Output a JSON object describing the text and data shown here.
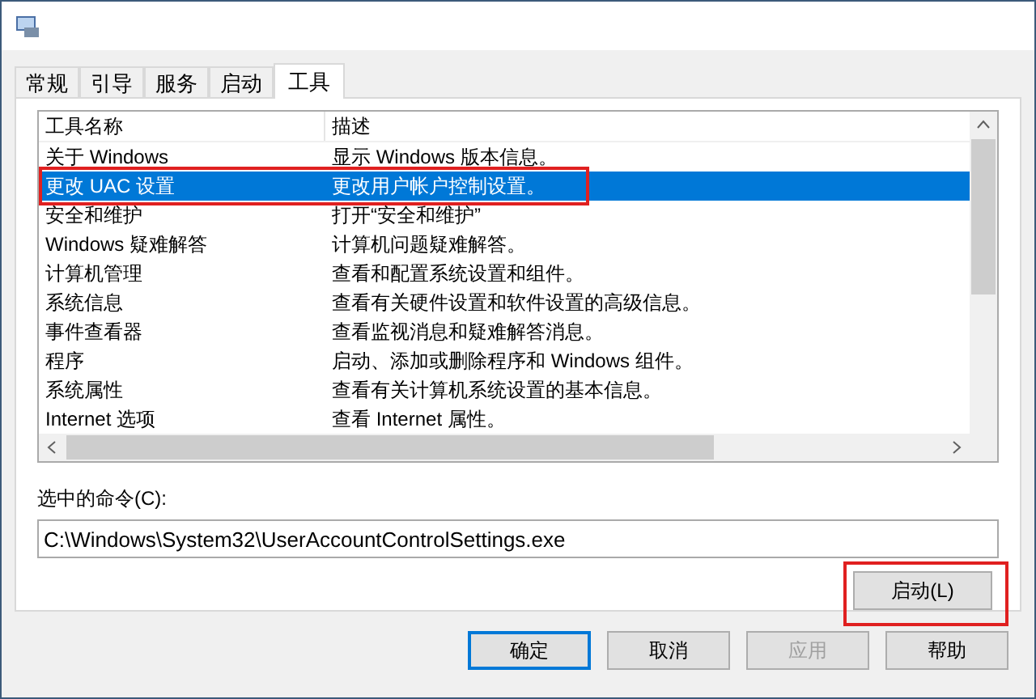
{
  "tabs": [
    {
      "label": "常规",
      "selected": false
    },
    {
      "label": "引导",
      "selected": false
    },
    {
      "label": "服务",
      "selected": false
    },
    {
      "label": "启动",
      "selected": false
    },
    {
      "label": "工具",
      "selected": true
    }
  ],
  "table": {
    "columns": [
      "工具名称",
      "描述"
    ],
    "rows": [
      {
        "name": "关于 Windows",
        "description": "显示 Windows 版本信息。",
        "selected": false,
        "highlighted": false
      },
      {
        "name": "更改 UAC 设置",
        "description": "更改用户帐户控制设置。",
        "selected": true,
        "highlighted": true
      },
      {
        "name": "安全和维护",
        "description": "打开“安全和维护”",
        "selected": false,
        "highlighted": false
      },
      {
        "name": "Windows 疑难解答",
        "description": "计算机问题疑难解答。",
        "selected": false,
        "highlighted": false
      },
      {
        "name": "计算机管理",
        "description": "查看和配置系统设置和组件。",
        "selected": false,
        "highlighted": false
      },
      {
        "name": "系统信息",
        "description": "查看有关硬件设置和软件设置的高级信息。",
        "selected": false,
        "highlighted": false
      },
      {
        "name": "事件查看器",
        "description": "查看监视消息和疑难解答消息。",
        "selected": false,
        "highlighted": false
      },
      {
        "name": "程序",
        "description": "启动、添加或删除程序和 Windows 组件。",
        "selected": false,
        "highlighted": false
      },
      {
        "name": "系统属性",
        "description": "查看有关计算机系统设置的基本信息。",
        "selected": false,
        "highlighted": false
      },
      {
        "name": "Internet 选项",
        "description": "查看 Internet 属性。",
        "selected": false,
        "highlighted": false
      }
    ]
  },
  "command": {
    "label": "选中的命令(C):",
    "value": "C:\\Windows\\System32\\UserAccountControlSettings.exe"
  },
  "launch_button": {
    "label": "启动(L)",
    "highlighted": true
  },
  "buttons": [
    {
      "label": "确定",
      "default": true,
      "disabled": false
    },
    {
      "label": "取消",
      "default": false,
      "disabled": false
    },
    {
      "label": "应用",
      "default": false,
      "disabled": true
    },
    {
      "label": "帮助",
      "default": false,
      "disabled": false
    }
  ]
}
